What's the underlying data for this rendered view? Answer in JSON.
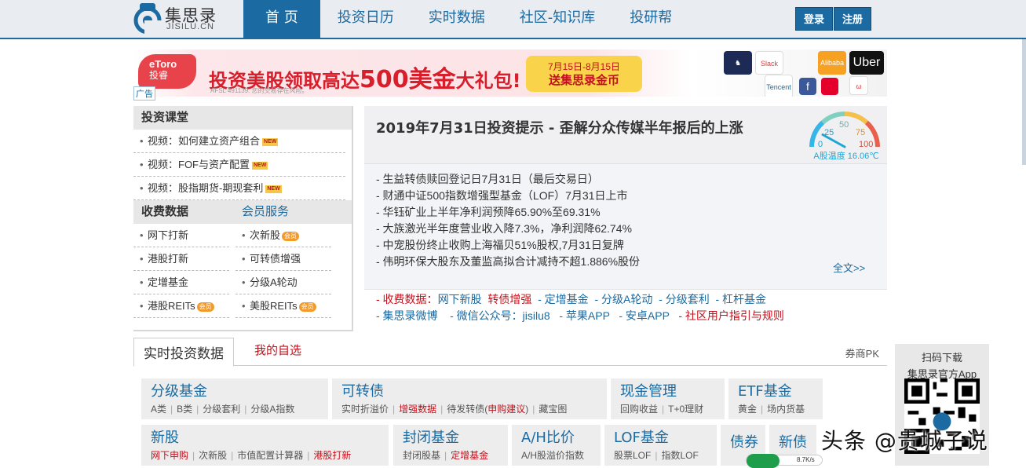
{
  "header": {
    "logo_cn": "集思录",
    "logo_en": "JISILU.CN",
    "nav": [
      "首 页",
      "投资日历",
      "实时数据",
      "社区-知识库",
      "投研帮"
    ],
    "login": "登录",
    "register": "注册"
  },
  "banner": {
    "brand_top": "eToro",
    "brand_cn": "投睿",
    "headline_pre": "投资美股领取高达",
    "headline_amount": "500美金",
    "headline_post": "大礼包!",
    "fine_print": "AFSL 491139. 您的交易存在风险。",
    "promo_dates": "7月15日-8月15日",
    "promo_text": "送集思录金币",
    "brand_tiles": [
      "Uber",
      "Alibaba",
      "Tencent",
      "Slack",
      "f"
    ],
    "ad_tag": "广告"
  },
  "left": {
    "classroom_title": "投资课堂",
    "classroom_items": [
      "视频：如何建立资产组合",
      "视频：FOF与资产配置",
      "视频：股指期货-期现套利"
    ],
    "new_tag": "NEW",
    "paid_title": "收费数据",
    "member_title": "会员服务",
    "paid_col": [
      "网下打新",
      "港股打新",
      "定增基金",
      "港股REITs"
    ],
    "member_col": [
      "次新股",
      "可转债增强",
      "分级A轮动",
      "美股REITs"
    ],
    "member_tag": "会员"
  },
  "tips": {
    "title": "2019年7月31日投资提示 - 歪解分众传媒半年报后的上涨",
    "items": [
      "- 生益转债赎回登记日7月31日（最后交易日）",
      "- 财通中证500指数增强型基金（LOF）7月31日上市",
      "- 华钰矿业上半年净利润预降65.90%至69.31%",
      "- 大族激光半年度营业收入降7.3%，净利润降62.74%",
      "- 中宠股份终止收购上海福贝51%股权,7月31日复牌",
      "- 伟明环保大股东及董监高拟合计减持不超1.886%股份"
    ],
    "more": "全文>>",
    "foot_row1": [
      {
        "t": "- 收费数据：",
        "c": "red"
      },
      {
        "t": "网下新股",
        "c": "blue"
      },
      {
        "t": "  转债增强",
        "c": "red"
      },
      {
        "t": "  - 定增基金",
        "c": "blue"
      },
      {
        "t": "  - 分级A轮动",
        "c": "blue"
      },
      {
        "t": "  - 分级套利",
        "c": "blue"
      },
      {
        "t": "  - 杠杆基金",
        "c": "blue"
      }
    ],
    "foot_row2": [
      {
        "t": "- 集思录微博",
        "c": "blue"
      },
      {
        "t": "    - 微信公众号：jisilu8",
        "c": "blue"
      },
      {
        "t": "   - 苹果APP",
        "c": "blue"
      },
      {
        "t": "   - 安卓APP",
        "c": "blue"
      },
      {
        "t": "   - 社区用户指引与规则",
        "c": "red"
      }
    ]
  },
  "gauge": {
    "ticks": [
      "0",
      "25",
      "50",
      "75",
      "100"
    ],
    "label": "A股温度 16.06℃",
    "value": 16.06
  },
  "realtime": {
    "tab_active": "实时投资数据",
    "tab_mine": "我的自选",
    "pk": "券商PK",
    "cards": [
      {
        "title": "分级基金",
        "subs": [
          {
            "t": "A类"
          },
          {
            "t": "B类"
          },
          {
            "t": "分级套利"
          },
          {
            "t": "分级A指数"
          }
        ]
      },
      {
        "title": "可转债",
        "subs": [
          {
            "t": "实时折溢价"
          },
          {
            "t": "增强数据",
            "r": true
          },
          {
            "t": "待发转债(申购建议)",
            "mixed": true
          },
          {
            "t": "藏宝图"
          }
        ]
      },
      {
        "title": "现金管理",
        "subs": [
          {
            "t": "回购收益"
          },
          {
            "t": "T+0理财"
          }
        ]
      },
      {
        "title": "ETF基金",
        "subs": [
          {
            "t": "黄金"
          },
          {
            "t": "场内货基"
          }
        ]
      },
      {
        "title": "新股",
        "subs": [
          {
            "t": "网下申购",
            "r": true
          },
          {
            "t": "次新股"
          },
          {
            "t": "市值配置计算器"
          },
          {
            "t": "港股打新",
            "r": true
          }
        ]
      },
      {
        "title": "封闭基金",
        "subs": [
          {
            "t": "封闭股基"
          },
          {
            "t": "定增基金",
            "r": true
          }
        ]
      },
      {
        "title": "A/H比价",
        "subs": [
          {
            "t": "A/H股溢价指数"
          }
        ]
      },
      {
        "title": "LOF基金",
        "subs": [
          {
            "t": "股票LOF"
          },
          {
            "t": "指数LOF"
          }
        ]
      },
      {
        "title": "债券",
        "subs": []
      },
      {
        "title": "新债",
        "subs": []
      }
    ]
  },
  "qr": {
    "line1": "扫码下载",
    "line2": "集思录官方App"
  },
  "speed": "8.7K/s",
  "watermark": "头条 @贵城子说"
}
